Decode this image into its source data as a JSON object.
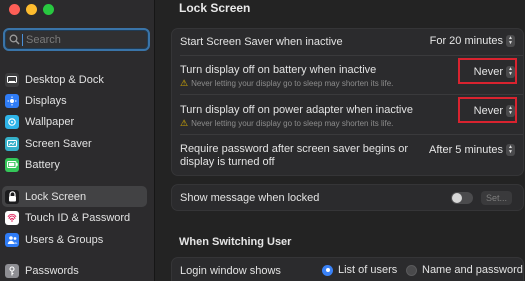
{
  "sidebar": {
    "search_placeholder": "Search",
    "items": [
      {
        "label": "Desktop & Dock",
        "icon": "desktop-dock-icon",
        "color": "#3d3d3f"
      },
      {
        "label": "Displays",
        "icon": "displays-icon",
        "color": "#2f7cf6"
      },
      {
        "label": "Wallpaper",
        "icon": "wallpaper-icon",
        "color": "#2fb4e8"
      },
      {
        "label": "Screen Saver",
        "icon": "screen-saver-icon",
        "color": "#35b0c9"
      },
      {
        "label": "Battery",
        "icon": "battery-icon",
        "color": "#34c759"
      },
      {
        "label": "Lock Screen",
        "icon": "lock-icon",
        "color": "#1c1c1e",
        "selected": true
      },
      {
        "label": "Touch ID & Password",
        "icon": "fingerprint-icon",
        "color": "#ffffff"
      },
      {
        "label": "Users & Groups",
        "icon": "users-icon",
        "color": "#2f7cf6"
      },
      {
        "label": "Passwords",
        "icon": "key-icon",
        "color": "#8e8e93"
      }
    ]
  },
  "main": {
    "title": "Lock Screen",
    "rows": {
      "screen_saver": {
        "label": "Start Screen Saver when inactive",
        "value": "For 20 minutes"
      },
      "battery": {
        "label": "Turn display off on battery when inactive",
        "value": "Never",
        "warning": "Never letting your display go to sleep may shorten its life."
      },
      "power": {
        "label": "Turn display off on power adapter when inactive",
        "value": "Never",
        "warning": "Never letting your display go to sleep may shorten its life."
      },
      "password": {
        "label_line1": "Require password after screen saver begins or",
        "label_line2": "display is turned off",
        "value": "After 5 minutes"
      },
      "message": {
        "label": "Show message when locked",
        "button": "Set...",
        "enabled": false
      }
    },
    "switching_title": "When Switching User",
    "login_window": {
      "label": "Login window shows",
      "options": [
        "List of users",
        "Name and password"
      ],
      "selected": "List of users"
    }
  },
  "colors": {
    "accent": "#3a82f7",
    "highlight": "#d9232f",
    "warning": "#e6b800"
  }
}
